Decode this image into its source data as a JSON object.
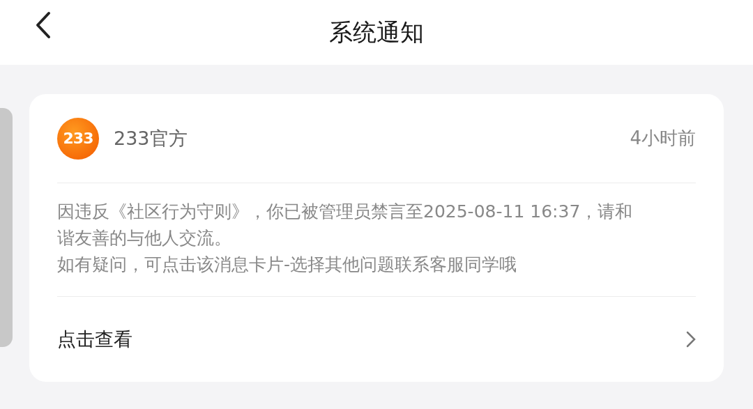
{
  "header": {
    "title": "系统通知"
  },
  "notification": {
    "sender": {
      "logo_text": "233",
      "name": "233官方"
    },
    "time": "4小时前",
    "message": [
      "因违反《社区行为守则》，你已被管理员禁言至2025-08-11 16:37，请和谐友善的与他人交流。",
      "如有疑问，可点击该消息卡片-选择其他问题联系客服同学哦"
    ],
    "action": "点击查看"
  }
}
